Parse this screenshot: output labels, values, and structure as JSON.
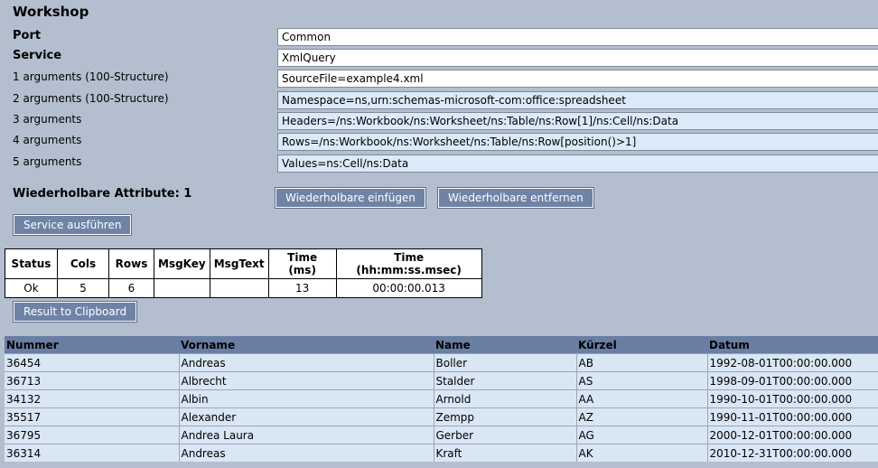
{
  "page": {
    "title": "Workshop"
  },
  "form": {
    "port": {
      "label": "Port",
      "value": "Common"
    },
    "service": {
      "label": "Service",
      "value": "XmlQuery"
    },
    "arguments": [
      {
        "label": "1 arguments (100-Structure)",
        "value": "SourceFile=example4.xml"
      },
      {
        "label": "2 arguments (100-Structure)",
        "value": "Namespace=ns,urn:schemas-microsoft-com:office:spreadsheet"
      },
      {
        "label": "3 arguments",
        "value": "Headers=/ns:Workbook/ns:Worksheet/ns:Table/ns:Row[1]/ns:Cell/ns:Data"
      },
      {
        "label": "4 arguments",
        "value": "Rows=/ns:Workbook/ns:Worksheet/ns:Table/ns:Row[position()>1]"
      },
      {
        "label": "5 arguments",
        "value": "Values=ns:Cell/ns:Data"
      }
    ]
  },
  "repeatable": {
    "label": "Wiederholbare Attribute: 1",
    "insert_label": "Wiederholbare einfügen",
    "remove_label": "Wiederholbare entfernen"
  },
  "run_button": "Service ausführen",
  "status_table": {
    "headers": [
      "Status",
      "Cols",
      "Rows",
      "MsgKey",
      "MsgText",
      "Time (ms)",
      "Time (hh:mm:ss.msec)"
    ],
    "row": [
      "Ok",
      "5",
      "6",
      "",
      "",
      "13",
      "00:00:00.013"
    ]
  },
  "clipboard_button": "Result to Clipboard",
  "results": {
    "headers": [
      "Nummer",
      "Vorname",
      "Name",
      "Kürzel",
      "Datum"
    ],
    "rows": [
      [
        "36454",
        "Andreas",
        "Boller",
        "AB",
        "1992-08-01T00:00:00.000"
      ],
      [
        "36713",
        "Albrecht",
        "Stalder",
        "AS",
        "1998-09-01T00:00:00.000"
      ],
      [
        "34132",
        "Albin",
        "Arnold",
        "AA",
        "1990-10-01T00:00:00.000"
      ],
      [
        "35517",
        "Alexander",
        "Zempp",
        "AZ",
        "1990-11-01T00:00:00.000"
      ],
      [
        "36795",
        "Andrea Laura",
        "Gerber",
        "AG",
        "2000-12-01T00:00:00.000"
      ],
      [
        "36314",
        "Andreas",
        "Kraft",
        "AK",
        "2010-12-31T00:00:00.000"
      ]
    ]
  }
}
